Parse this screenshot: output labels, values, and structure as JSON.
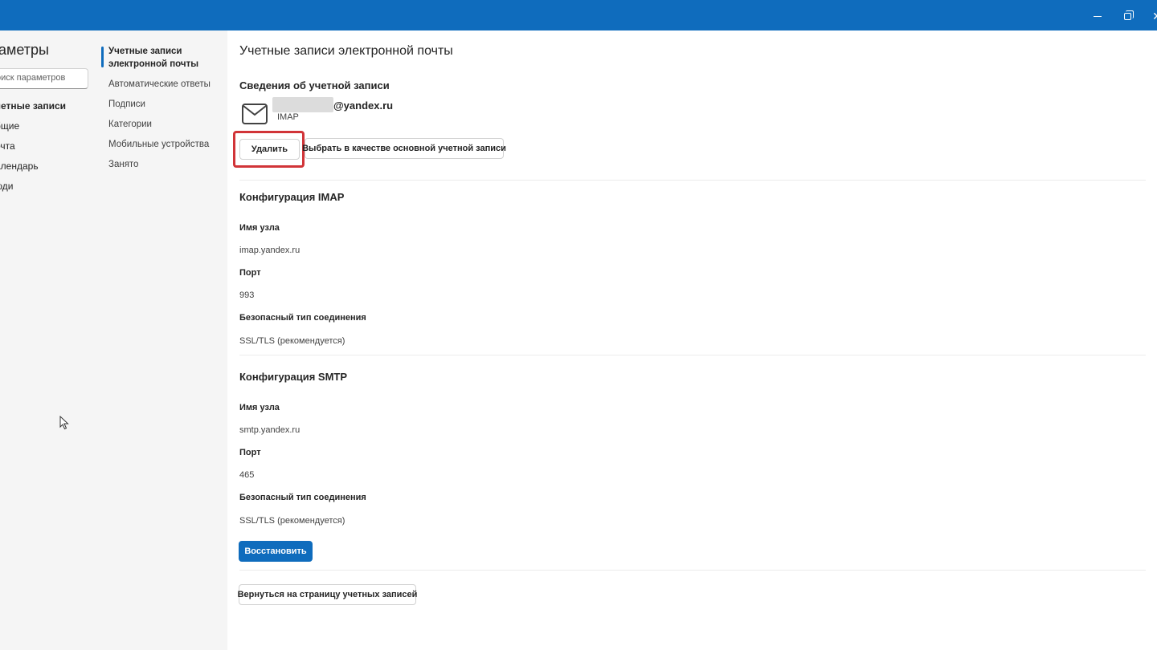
{
  "window": {
    "minimize_icon": "minimize-icon",
    "restore_icon": "restore-icon",
    "close_glyph": "✕"
  },
  "sidebar": {
    "title": "аметры",
    "search_placeholder": "оиск параметров",
    "categories": [
      {
        "label": "четные записи",
        "active": true
      },
      {
        "label": "бщие",
        "active": false
      },
      {
        "label": "очта",
        "active": false
      },
      {
        "label": "алендарь",
        "active": false
      },
      {
        "label": "юди",
        "active": false
      }
    ]
  },
  "subnav": {
    "items": [
      {
        "label": "Учетные записи\nэлектронной почты",
        "active": true
      },
      {
        "label": "Автоматические ответы",
        "active": false
      },
      {
        "label": "Подписи",
        "active": false
      },
      {
        "label": "Категории",
        "active": false
      },
      {
        "label": "Мобильные устройства",
        "active": false
      },
      {
        "label": "Занято",
        "active": false
      }
    ]
  },
  "main": {
    "page_title": "Учетные записи электронной почты",
    "account_section_title": "Сведения об учетной записи",
    "account": {
      "email_domain": "@yandex.ru",
      "type": "IMAP",
      "icon": "mail-icon"
    },
    "buttons": {
      "delete": "Удалить",
      "set_primary": "Выбрать в качестве основной учетной записи",
      "restore": "Восстановить",
      "back": "Вернуться на страницу учетных записей"
    },
    "imap": {
      "title": "Конфигурация IMAP",
      "host_label": "Имя узла",
      "host_value": "imap.yandex.ru",
      "port_label": "Порт",
      "port_value": "993",
      "security_label": "Безопасный тип соединения",
      "security_value": "SSL/TLS (рекомендуется)"
    },
    "smtp": {
      "title": "Конфигурация SMTP",
      "host_label": "Имя узла",
      "host_value": "smtp.yandex.ru",
      "port_label": "Порт",
      "port_value": "465",
      "security_label": "Безопасный тип соединения",
      "security_value": "SSL/TLS (рекомендуется)"
    }
  },
  "colors": {
    "accent": "#0f6cbd",
    "highlight": "#d13438",
    "pane_bg": "#f5f5f5"
  }
}
